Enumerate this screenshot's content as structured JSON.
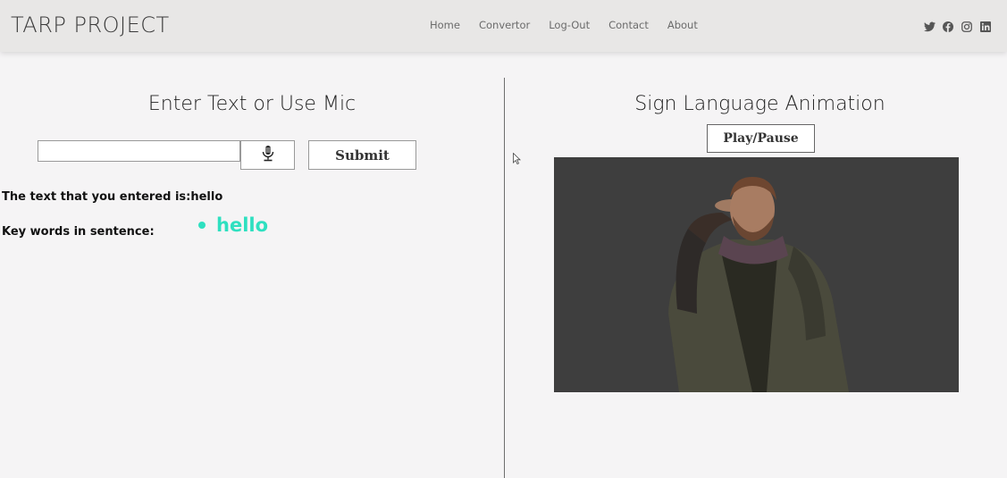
{
  "navbar": {
    "brand": "TARP PROJECT",
    "links": [
      "Home",
      "Convertor",
      "Log-Out",
      "Contact",
      "About"
    ],
    "social_icons": [
      "twitter-icon",
      "facebook-icon",
      "instagram-icon",
      "linkedin-icon"
    ]
  },
  "left": {
    "title": "Enter Text or Use Mic",
    "input_value": "",
    "submit_label": "Submit",
    "entered_label": "The text that you entered is:",
    "entered_value": "hello",
    "keywords_label": "Key words in sentence:",
    "keywords": [
      "hello"
    ]
  },
  "right": {
    "title": "Sign Language Animation",
    "play_label": "Play/Pause"
  },
  "colors": {
    "accent": "#2ee0c0",
    "navbar_bg": "#e8e7e6",
    "page_bg": "#f5f4f5",
    "video_bg": "#3e3e3e"
  }
}
